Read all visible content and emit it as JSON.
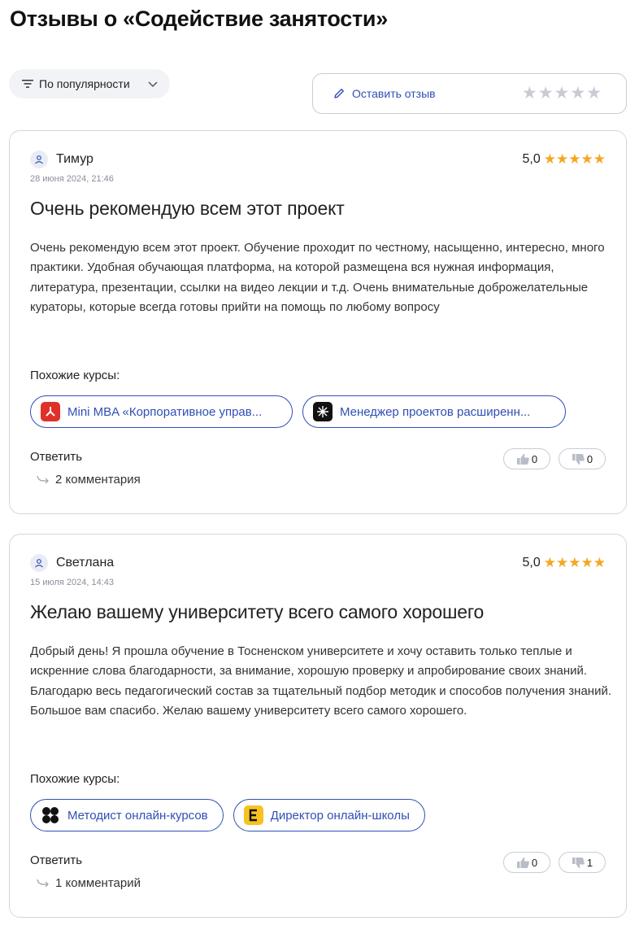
{
  "page": {
    "title": "Отзывы о «Содействие занятости»"
  },
  "toolbar": {
    "sort_label": "По популярности",
    "leave_review_label": "Оставить отзыв",
    "empty_stars": [
      "★",
      "★",
      "★",
      "★",
      "★"
    ]
  },
  "colors": {
    "accent": "#2f4fb5",
    "star": "#f5a623",
    "star_empty": "#c9cbd3"
  },
  "reviews": [
    {
      "author": "Тимур",
      "date": "28 июня 2024, 21:46",
      "rating": "5,0",
      "stars": [
        "★",
        "★",
        "★",
        "★",
        "★"
      ],
      "title": "Очень рекомендую всем этот проект",
      "text": "Очень рекомендую всем этот проект. Обучение проходит по честному, насыщенно, интересно, много практики. Удобная обучающая платформа, на которой размещена вся нужная информация, литература, презентации, ссылки на видео лекции и т.д. Очень внимательные доброжелательные кураторы, которые всегда готовы прийти на помощь по любому вопросу",
      "similar_label": "Похожие курсы:",
      "courses": [
        {
          "label": "Mini MBA «Корпоративное управ...",
          "icon": "red-logo-icon"
        },
        {
          "label": "Менеджер проектов расширенн...",
          "icon": "black-spark-icon"
        }
      ],
      "reply_label": "Ответить",
      "comments_label": "2 комментария",
      "likes": "0",
      "dislikes": "0"
    },
    {
      "author": "Светлана",
      "date": "15 июля 2024, 14:43",
      "rating": "5,0",
      "stars": [
        "★",
        "★",
        "★",
        "★",
        "★"
      ],
      "title": "Желаю вашему университету всего самого хорошего",
      "text": "Добрый день! Я прошла обучение в Тосненском университете и хочу оставить только теплые и искренние слова благодарности, за внимание, хорошую проверку и апробирование своих знаний. Благодарю весь педагогический состав за тщательный подбор методик и способов получения знаний. Большое вам спасибо. Желаю вашему университету всего самого хорошего.",
      "similar_label": "Похожие курсы:",
      "courses": [
        {
          "label": "Методист онлайн-курсов",
          "icon": "black-dots-icon"
        },
        {
          "label": "Директор онлайн-школы",
          "icon": "yellow-e-icon"
        }
      ],
      "reply_label": "Ответить",
      "comments_label": "1 комментарий",
      "likes": "0",
      "dislikes": "1"
    }
  ]
}
